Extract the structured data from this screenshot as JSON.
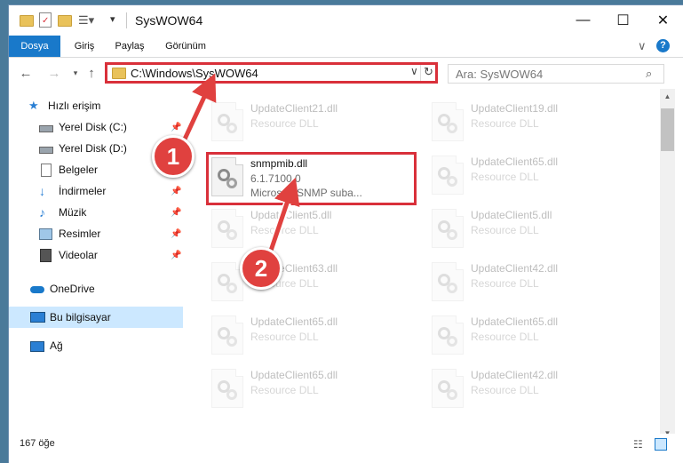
{
  "window": {
    "title": "SysWOW64"
  },
  "ribbon": {
    "tabs": [
      "Dosya",
      "Giriş",
      "Paylaş",
      "Görünüm"
    ]
  },
  "address": {
    "path": "C:\\Windows\\SysWOW64"
  },
  "search": {
    "placeholder": "Ara: SysWOW64"
  },
  "sidebar": {
    "items": [
      {
        "label": "Hızlı erişim",
        "icon": "star-icon"
      },
      {
        "label": "Yerel Disk (C:)",
        "icon": "drive-icon"
      },
      {
        "label": "Yerel Disk (D:)",
        "icon": "drive-icon"
      },
      {
        "label": "Belgeler",
        "icon": "document-icon"
      },
      {
        "label": "İndirmeler",
        "icon": "download-icon"
      },
      {
        "label": "Müzik",
        "icon": "music-icon"
      },
      {
        "label": "Resimler",
        "icon": "picture-icon"
      },
      {
        "label": "Videolar",
        "icon": "video-icon"
      },
      {
        "label": "OneDrive",
        "icon": "cloud-icon"
      },
      {
        "label": "Bu bilgisayar",
        "icon": "computer-icon"
      },
      {
        "label": "Ağ",
        "icon": "network-icon"
      }
    ]
  },
  "files": [
    {
      "name": "UpdateClient21.dll",
      "desc": "Resource DLL"
    },
    {
      "name": "UpdateClient19.dll",
      "desc": "Resource DLL"
    },
    {
      "name": "snmpmib.dll",
      "version": "6.1.7100.0",
      "desc": "Microsoft SNMP suba..."
    },
    {
      "name": "UpdateClient65.dll",
      "desc": "Resource DLL"
    },
    {
      "name": "UpdateClient5.dll",
      "desc": "Resource DLL"
    },
    {
      "name": "UpdateClient5.dll",
      "desc": "Resource DLL"
    },
    {
      "name": "UpdateClient63.dll",
      "desc": "Resource DLL"
    },
    {
      "name": "UpdateClient42.dll",
      "desc": "Resource DLL"
    },
    {
      "name": "UpdateClient65.dll",
      "desc": "Resource DLL"
    },
    {
      "name": "UpdateClient65.dll",
      "desc": "Resource DLL"
    },
    {
      "name": "UpdateClient65.dll",
      "desc": "Resource DLL"
    },
    {
      "name": "UpdateClient42.dll",
      "desc": "Resource DLL"
    }
  ],
  "status": {
    "count": "167 öğe"
  },
  "callouts": [
    "1",
    "2"
  ],
  "colors": {
    "accent": "#1979ca",
    "highlight": "#d9303a",
    "selection": "#cce8ff"
  }
}
